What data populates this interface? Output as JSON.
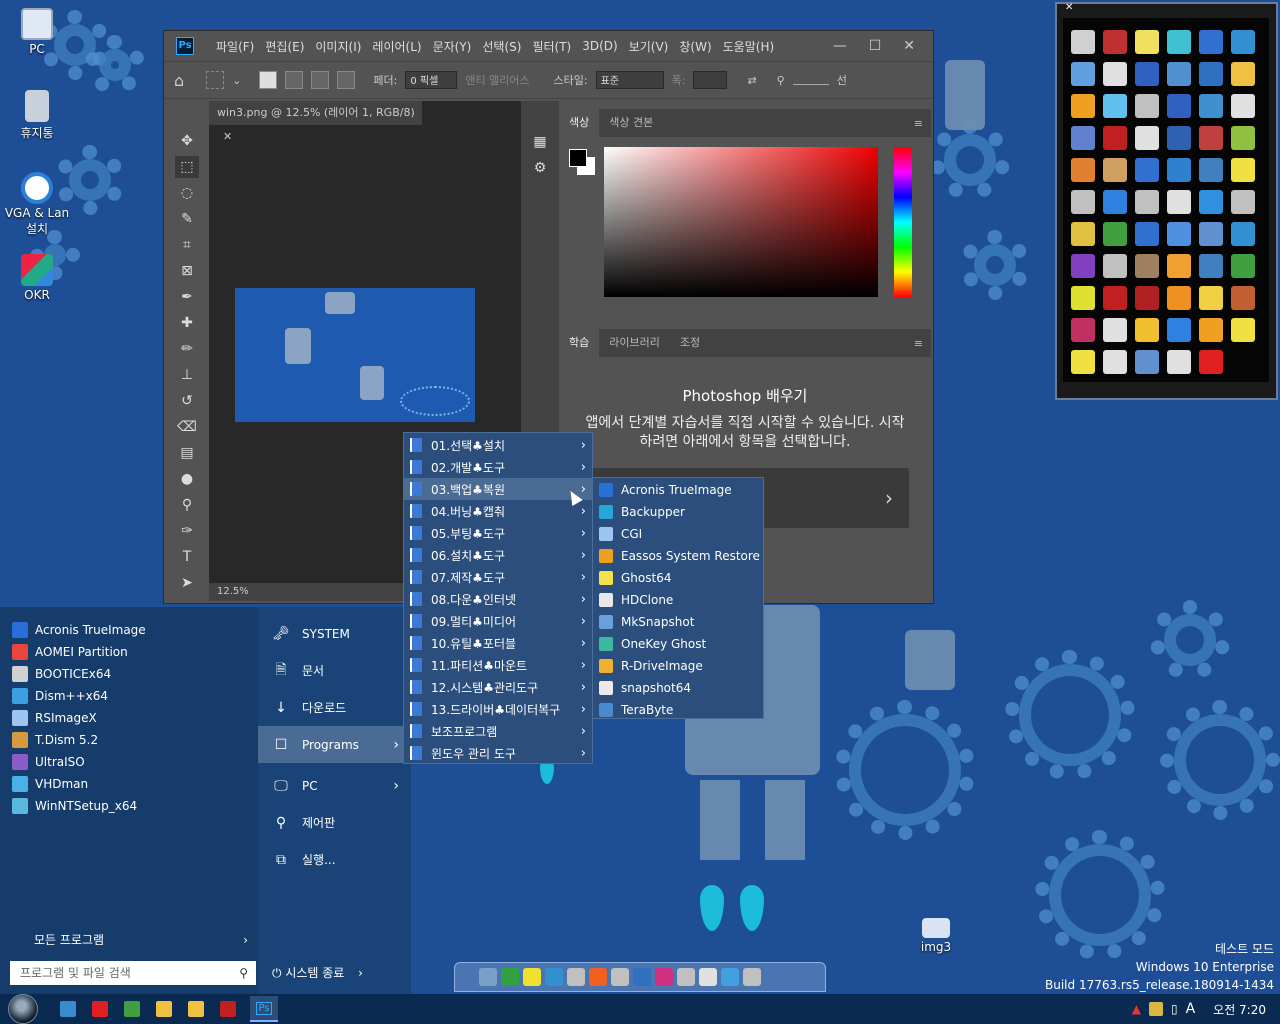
{
  "desktop": {
    "icons": [
      {
        "label": "PC"
      },
      {
        "label": "휴지통"
      },
      {
        "label": "VGA & Lan 설치"
      },
      {
        "label": "OKR"
      },
      {
        "label": "img3"
      }
    ],
    "watermark": {
      "line1": "테스트 모드",
      "line2": "Windows 10 Enterprise",
      "line3": "Build 17763.rs5_release.180914-1434"
    }
  },
  "photoshop": {
    "logo": "Ps",
    "menus": [
      "파일(F)",
      "편집(E)",
      "이미지(I)",
      "레이어(L)",
      "문자(Y)",
      "선택(S)",
      "필터(T)",
      "3D(D)",
      "보기(V)",
      "창(W)",
      "도움말(H)"
    ],
    "window_buttons": [
      "—",
      "☐",
      "✕"
    ],
    "options": {
      "feather_label": "페더:",
      "feather_value": "0 픽셀",
      "antialias_label": "앤티 앨리어스",
      "style_label": "스타일:",
      "style_value": "표준",
      "width_label": "폭:",
      "select_label": "선"
    },
    "doc_tab": "win3.png @ 12.5% (레이어 1, RGB/8)",
    "doc_tab_close": "✕",
    "zoom_status": "12.5%",
    "color_panel_tabs": [
      "색상",
      "색상 견본"
    ],
    "lower_panel_tabs": [
      "학습",
      "라이브러리",
      "조정"
    ],
    "learn_title": "Photoshop 배우기",
    "learn_text": "앱에서 단계별 자습서를 직접 시작할 수 있습니다. 시작하려면 아래에서 항목을 선택합니다.",
    "learn_card_arrow": "›"
  },
  "start_menu": {
    "pinned_programs": [
      {
        "label": "Acronis TrueImage",
        "color": "#2a6fd6"
      },
      {
        "label": "AOMEI Partition",
        "color": "#e6463c"
      },
      {
        "label": "BOOTICEx64",
        "color": "#d0d0d0"
      },
      {
        "label": "Dism++x64",
        "color": "#3aa0e0"
      },
      {
        "label": "RSImageX",
        "color": "#9cc6f0"
      },
      {
        "label": "T.Dism 5.2",
        "color": "#d89a40"
      },
      {
        "label": "UltraISO",
        "color": "#8a5cc8"
      },
      {
        "label": "VHDman",
        "color": "#4ab0e8"
      },
      {
        "label": "WinNTSetup_x64",
        "color": "#5ab8e0"
      }
    ],
    "all_programs": "모든 프로그램",
    "search_placeholder": "프로그램 및 파일 검색",
    "right_items": [
      {
        "label": "SYSTEM",
        "icon": "🗝"
      },
      {
        "label": "문서",
        "icon": "🗎"
      },
      {
        "label": "다운로드",
        "icon": "↓"
      },
      {
        "label": "Programs",
        "icon": "☐"
      },
      {
        "label": "PC",
        "icon": "🖵"
      },
      {
        "label": "제어판",
        "icon": "⚲"
      },
      {
        "label": "실행...",
        "icon": "⧉"
      }
    ],
    "shutdown": "시스템 종료"
  },
  "programs_menu": [
    "01.선택♣설치",
    "02.개발♣도구",
    "03.백업♣복원",
    "04.버닝♣캡춰",
    "05.부팅♣도구",
    "06.설치♣도구",
    "07.제작♣도구",
    "08.다운♣인터넷",
    "09.멀티♣미디어",
    "10.유틸♣포터블",
    "11.파티션♣마운트",
    "12.시스템♣관리도구",
    "13.드라이버♣데이터복구",
    "보조프로그램",
    "윈도우 관리 도구"
  ],
  "backup_menu": [
    {
      "label": "Acronis TrueImage",
      "color": "#2a6fd6"
    },
    {
      "label": "Backupper",
      "color": "#25a7d9"
    },
    {
      "label": "CGI",
      "color": "#9cc6f0"
    },
    {
      "label": "Eassos System Restore",
      "color": "#f0a020"
    },
    {
      "label": "Ghost64",
      "color": "#f2e34a"
    },
    {
      "label": "HDClone",
      "color": "#e8e8e8"
    },
    {
      "label": "MkSnapshot",
      "color": "#6aa0d8"
    },
    {
      "label": "OneKey Ghost",
      "color": "#3cb8a0"
    },
    {
      "label": "R-DriveImage",
      "color": "#f0b030"
    },
    {
      "label": "snapshot64",
      "color": "#eaeaea"
    },
    {
      "label": "TeraByte",
      "color": "#4a8ad0"
    }
  ],
  "taskbar": {
    "clock": "오전 7:20",
    "ime": "A",
    "ps_label": "Ps"
  },
  "tray_icons": [
    "#d0d0d0",
    "#c03030",
    "#f0e060",
    "#40c0d0",
    "#3070d0",
    "#3090d0",
    "#60a0e0",
    "#e0e0e0",
    "#3060c0",
    "#5090d0",
    "#3070c0",
    "#f0c040",
    "#f0a020",
    "#60c0f0",
    "#c0c0c0",
    "#3060c0",
    "#4090d0",
    "#e0e0e0",
    "#6080d0",
    "#c02020",
    "#e0e0e0",
    "#3060b0",
    "#c04040",
    "#90c040",
    "#e08030",
    "#d0a060",
    "#3070d0",
    "#3080d0",
    "#4080c0",
    "#f0e040",
    "#c0c0c0",
    "#3080e0",
    "#c0c0c0",
    "#e0e0e0",
    "#3090e0",
    "#c0c0c0",
    "#e0c040",
    "#40a040",
    "#3070d0",
    "#5090e0",
    "#6090d0",
    "#3090d0",
    "#8040c0",
    "#c0c0c0",
    "#a08060",
    "#f0a030",
    "#4080c0",
    "#40a040",
    "#e0e030",
    "#c02020",
    "#b02020",
    "#f09020",
    "#f0d040",
    "#c06030",
    "#c03060",
    "#e0e0e0",
    "#f0c030",
    "#3080e0",
    "#f0a020",
    "#f0e040",
    "#f0e040",
    "#e0e0e0",
    "#6090d0",
    "#e0e0e0",
    "#e02020"
  ],
  "dock_icons": [
    "#7aa0c8",
    "#30a040",
    "#f0e030",
    "#3090d0",
    "#c0c0c0",
    "#f06020",
    "#c0c0c0",
    "#3070c0",
    "#d03080",
    "#c0c0c0",
    "#e0e0e0",
    "#40a0e0",
    "#c0c0c0"
  ],
  "taskbar_icons": [
    "#3a8ad0",
    "#e02020",
    "#40a040",
    "#f0c040",
    "#f0c040",
    "#c02020"
  ]
}
